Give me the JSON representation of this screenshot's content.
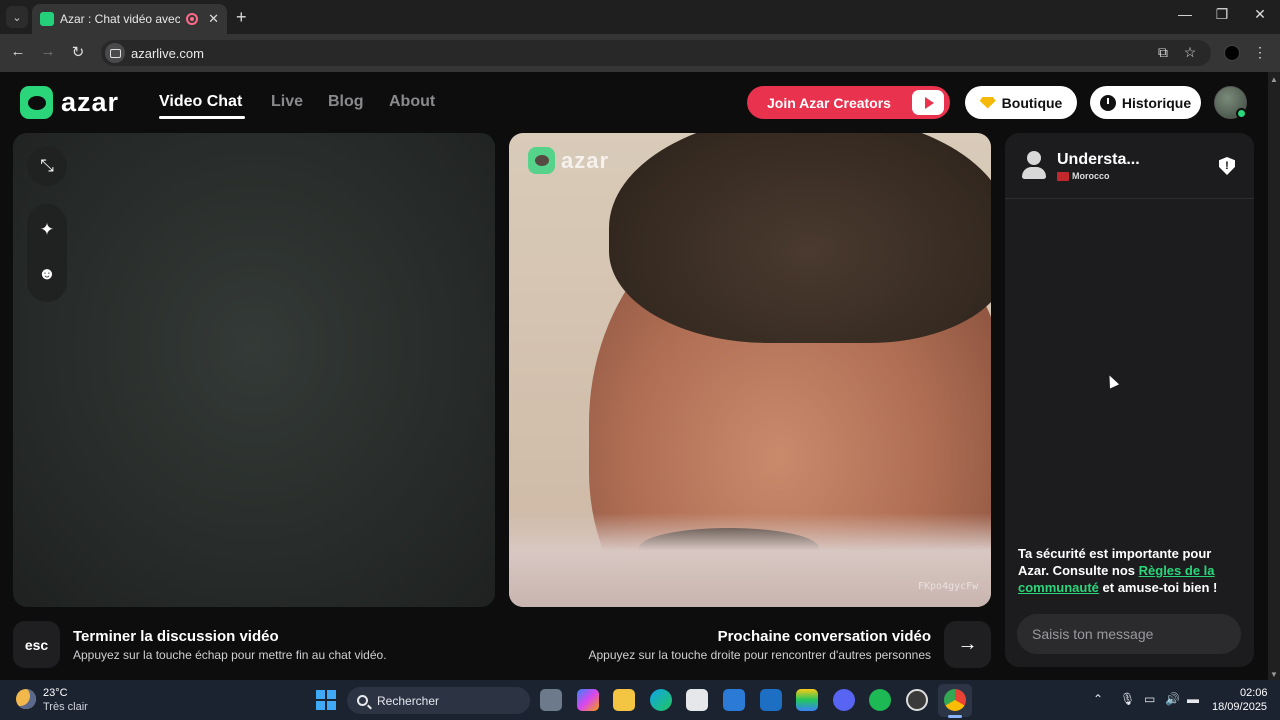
{
  "browser": {
    "tab_title": "Azar : Chat vidéo avec de n",
    "url": "azarlive.com"
  },
  "header": {
    "logo_text": "azar",
    "nav": [
      {
        "label": "Video Chat",
        "active": true
      },
      {
        "label": "Live",
        "active": false
      },
      {
        "label": "Blog",
        "active": false
      },
      {
        "label": "About",
        "active": false
      }
    ],
    "creators_label": "Join Azar Creators",
    "boutique_label": "Boutique",
    "history_label": "Historique"
  },
  "remote_video": {
    "logo_text": "azar",
    "watermark": "FKpo4gycFw"
  },
  "chat": {
    "partner_name": "Understa...",
    "partner_country": "Morocco",
    "safety_text_before": "Ta sécurité est importante pour Azar. Consulte nos ",
    "safety_link": "Règles de la communauté",
    "safety_text_after": " et amuse-toi bien !",
    "input_placeholder": "Saisis ton message"
  },
  "controls": {
    "esc_label": "esc",
    "end_title": "Terminer la discussion vidéo",
    "end_subtitle": "Appuyez sur la touche échap pour mettre fin au chat vidéo.",
    "next_title": "Prochaine conversation vidéo",
    "next_subtitle": "Appuyez sur la touche droite pour rencontrer d'autres personnes"
  },
  "taskbar": {
    "temperature": "23°C",
    "condition": "Très clair",
    "search_label": "Rechercher",
    "time": "02:06",
    "date": "18/09/2025"
  },
  "colors": {
    "brand_green": "#2bd67b",
    "creators_red": "#e8324e"
  }
}
